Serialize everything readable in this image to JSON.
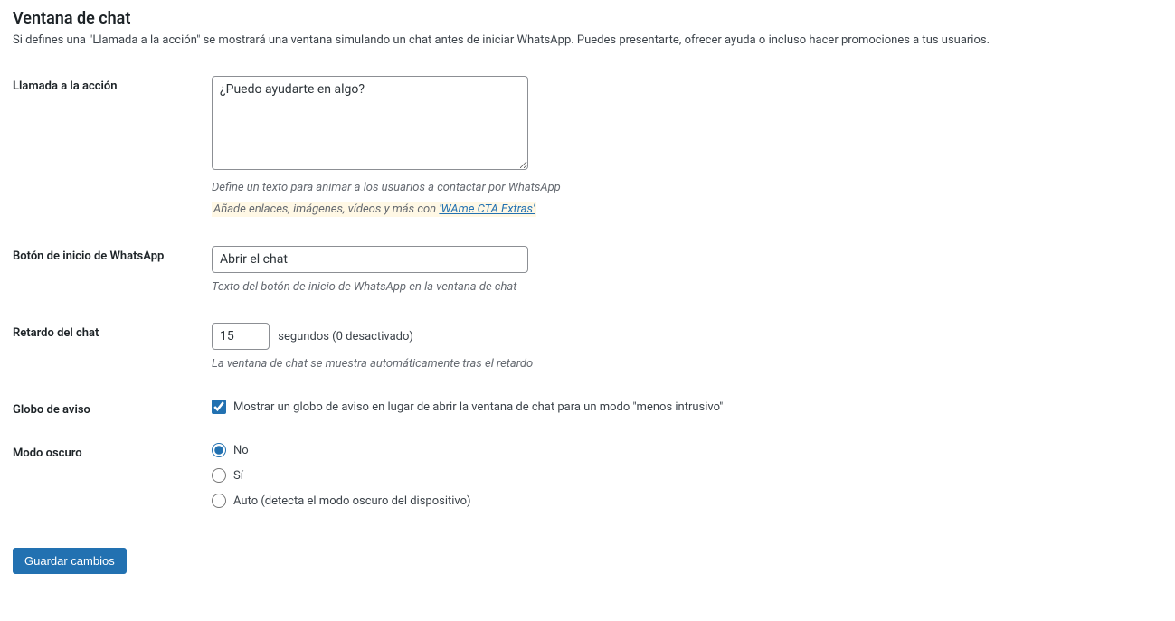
{
  "section": {
    "title": "Ventana de chat",
    "description": "Si defines una \"Llamada a la acción\" se mostrará una ventana simulando un chat antes de iniciar WhatsApp. Puedes presentarte, ofrecer ayuda o incluso hacer promociones a tus usuarios."
  },
  "fields": {
    "cta": {
      "label": "Llamada a la acción",
      "value": "¿Puedo ayudarte en algo?",
      "description": "Define un texto para animar a los usuarios a contactar por WhatsApp",
      "extras_prefix": "Añade enlaces, imágenes, vídeos y más con ",
      "extras_link": "'WAme CTA Extras'"
    },
    "button": {
      "label": "Botón de inicio de WhatsApp",
      "value": "Abrir el chat",
      "description": "Texto del botón de inicio de WhatsApp en la ventana de chat"
    },
    "delay": {
      "label": "Retardo del chat",
      "value": "15",
      "suffix": "segundos (0 desactivado)",
      "description": "La ventana de chat se muestra automáticamente tras el retardo"
    },
    "badge": {
      "label": "Globo de aviso",
      "checkbox_label": "Mostrar un globo de aviso en lugar de abrir la ventana de chat para un modo \"menos intrusivo\""
    },
    "darkmode": {
      "label": "Modo oscuro",
      "options": {
        "no": "No",
        "yes": "Sí",
        "auto": "Auto (detecta el modo oscuro del dispositivo)"
      }
    }
  },
  "submit": {
    "label": "Guardar cambios"
  }
}
